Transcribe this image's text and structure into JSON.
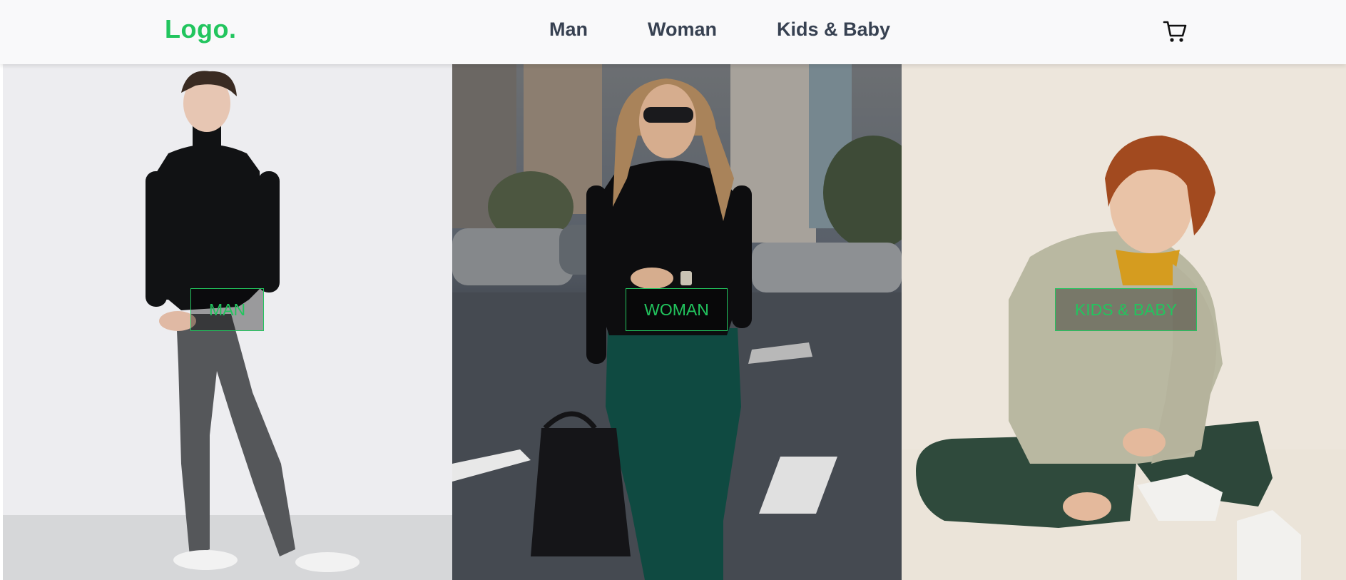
{
  "navbar": {
    "logo": "Logo.",
    "links": [
      "Man",
      "Woman",
      "Kids & Baby"
    ],
    "cart_icon": "shopping-cart-icon"
  },
  "categories": [
    {
      "button_label": "MAN"
    },
    {
      "button_label": "WOMAN"
    },
    {
      "button_label": "KIDS & BABY"
    }
  ],
  "colors": {
    "accent": "#22c55e",
    "nav_text": "#374151",
    "nav_background": "#f9f9fa"
  }
}
